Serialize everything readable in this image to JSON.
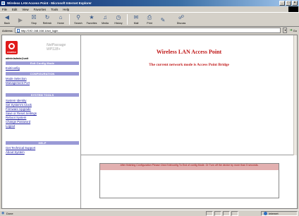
{
  "window": {
    "title": "Wireless LAN Access Point - Microsoft Internet Explorer"
  },
  "menu": [
    "File",
    "Edit",
    "View",
    "Favorites",
    "Tools",
    "Help"
  ],
  "toolbar": {
    "back": "Back",
    "forward": "",
    "stop": "Stop",
    "refresh": "Refresh",
    "home": "Home",
    "search": "Search",
    "favorites": "Favorites",
    "media": "Media",
    "history": "History",
    "mail": "Mail",
    "print": "Print",
    "edit": "",
    "discuss": "Discuss"
  },
  "address": {
    "label": "Address",
    "url": "http://192.168.168.1/act_login",
    "go": "Go"
  },
  "sidebar": {
    "logo_text": "COMPEX",
    "product_line1": "NetPassage",
    "product_line2": "WP11B+",
    "user": "admin/admin@unit",
    "mode_banner": "Exit Config Mode",
    "exit_link": "Exit/config",
    "configuration_head": "CONFIGURATION",
    "configuration_items": [
      "Mode Selection",
      "Management Port"
    ],
    "system_tools_head": "SYSTEM TOOLS",
    "system_tools_items": [
      "System Identity",
      "Set System's Clock",
      "Firmware Upgrade",
      "Save or Reset Settings",
      "Reboot System",
      "Change Password",
      "Logout"
    ],
    "help_head": "HELP",
    "help_items": [
      "Get Technical Support",
      "About System"
    ]
  },
  "main": {
    "title": "Wireless LAN Access Point",
    "mode_text": "The current network mode is Access Point Bridge"
  },
  "bottom": {
    "note": "After finishing Configuration Please Click Exit/config To End of config Mode. Or Turn off the device by more than 5 seconds."
  },
  "status": {
    "left": "Done",
    "zone": "Internet"
  }
}
